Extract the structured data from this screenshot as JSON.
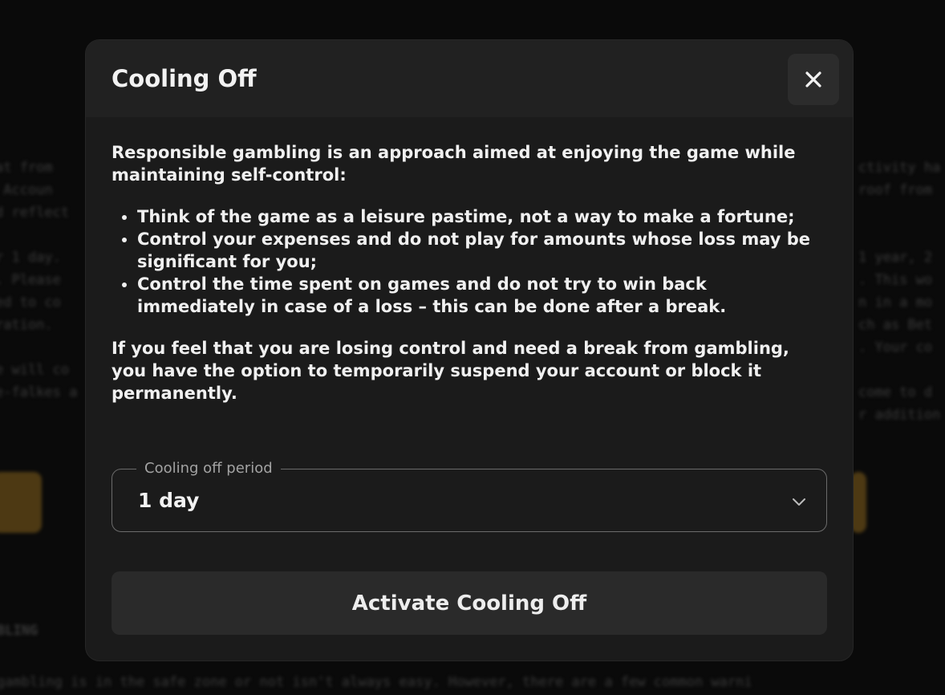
{
  "modal": {
    "title": "Cooling Off",
    "intro": "Responsible gambling is an approach aimed at enjoying the game while maintaining self-control:",
    "tips": [
      "Think of the game as a leisure pastime, not a way to make a fortune;",
      "Control your expenses and do not play for amounts whose loss may be significant for you;",
      "Control the time spent on games and do not try to win back immediately in case of a loss – this can be done after a break."
    ],
    "outro": "If you feel that you are losing control and need a break from gambling, you have the option to temporarily suspend your account or block it permanently.",
    "period_field": {
      "label": "Cooling off period",
      "value": "1 day"
    },
    "activate_label": "Activate Cooling Off"
  },
  "icons": {
    "close": "close-icon",
    "dropdown": "chevron-down-icon"
  },
  "colors": {
    "modal_bg": "#1b1b1b",
    "header_bg": "#212121",
    "button_bg": "#2a2a2a",
    "text": "#f0f0f0",
    "muted": "#a3a3a3"
  }
}
